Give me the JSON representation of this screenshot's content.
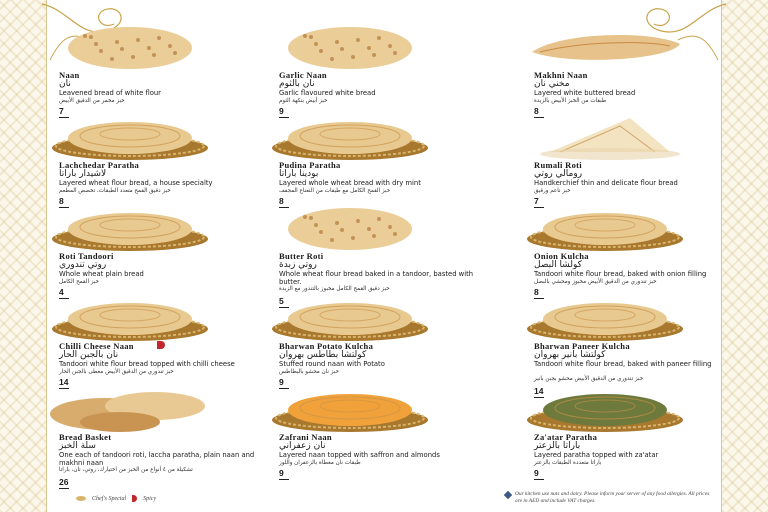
{
  "menu": {
    "items": [
      {
        "name": "Naan",
        "ar": "نان",
        "desc": "Leavened bread of white flour",
        "ardesc": "خبز مخمر من الدقيق الأبيض",
        "price": "7",
        "bread": "round",
        "spicy": false
      },
      {
        "name": "Garlic Naan",
        "ar": "نان بالثوم",
        "desc": "Garlic flavoured white bread",
        "ardesc": "خبز أبيض بنكهة الثوم",
        "price": "9",
        "bread": "round",
        "spicy": false
      },
      {
        "name": "Makhni Naan",
        "ar": "مخني نان",
        "desc": "Layered white buttered bread",
        "ardesc": "طبقات من الخبز الأبيض بالزبدة",
        "price": "8",
        "bread": "long",
        "spicy": false
      },
      {
        "name": "Lachchedar Paratha",
        "ar": "لاشيدار باراتا",
        "desc": "Layered wheat flour bread, a house specialty",
        "ardesc": "خبز دقيق القمح متعدد الطبقات، تخصص المطعم",
        "price": "8",
        "bread": "basket",
        "spicy": false
      },
      {
        "name": "Pudina Paratha",
        "ar": "بودينا باراتا",
        "desc": "Layered whole wheat bread with dry mint",
        "ardesc": "خبز القمح الكامل مع طبقات من النعناع المجفف",
        "price": "8",
        "bread": "basket",
        "spicy": false
      },
      {
        "name": "Rumali Roti",
        "ar": "رومالي روتي",
        "desc": "Handkerchief thin and delicate flour bread",
        "ardesc": "خبز ناعم ورقيق",
        "price": "7",
        "bread": "folded",
        "spicy": false
      },
      {
        "name": "Roti Tandoori",
        "ar": "روتي تندوري",
        "desc": "Whole wheat plain bread",
        "ardesc": "خبز القمح الكامل",
        "price": "4",
        "bread": "basket",
        "spicy": false
      },
      {
        "name": "Butter Roti",
        "ar": "روتي زبدة",
        "desc": "Whole wheat flour bread baked in a tandoor, basted with butter.",
        "ardesc": "خبز دقيق القمح الكامل مخبوز بالتندور مع الزبدة",
        "price": "5",
        "bread": "round",
        "spicy": false
      },
      {
        "name": "Onion Kulcha",
        "ar": "كولشا البصل",
        "desc": "Tandoori white flour bread, baked with onion filling",
        "ardesc": "خبز تندوري من الدقيق الأبيض مخبوز ومحشي بالبصل",
        "price": "8",
        "bread": "basket",
        "spicy": false
      },
      {
        "name": "Chilli Cheese Naan",
        "ar": "نان بالجبن الحار",
        "desc": "Tandoori white flour bread topped with chilli cheese",
        "ardesc": "خبز تندوري من الدقيق الأبيض مغطى بالجبن الحار",
        "price": "14",
        "bread": "basket",
        "spicy": true
      },
      {
        "name": "Bharwan Potato Kulcha",
        "ar": "كولتشا بطاطس بهروان",
        "desc": "Stuffed round naan with Potato",
        "ardesc": "خبز نان محشو بالبطاطس",
        "price": "9",
        "bread": "basket",
        "spicy": false
      },
      {
        "name": "Bharwan Paneer Kulcha",
        "ar": "كولتشا بانير بهروان",
        "desc": "Tandoori white flour bread, baked with paneer filling",
        "ardesc": "خبز تندوري من الدقيق الأبيض محشو بجبن بانير",
        "price": "14",
        "bread": "basket",
        "spicy": false
      },
      {
        "name": "Bread Basket",
        "ar": "سلة الخبز",
        "desc": "One each of tandoori roti, laccha paratha, plain naan and makhni naan",
        "ardesc": "تشكيلة من ٤ أنواع من الخبز من اختيارك، روتي، نان، باراتا",
        "price": "26",
        "bread": "pile",
        "spicy": false
      },
      {
        "name": "Zafrani Naan",
        "ar": "نان زعفراني",
        "desc": "Layered naan topped with saffron and almonds",
        "ardesc": "طبقات نان مغطاة بالزعفران واللوز",
        "price": "9",
        "bread": "saffron",
        "spicy": false
      },
      {
        "name": "Za'atar Paratha",
        "ar": "باراتا بالزعتر",
        "desc": "Layered paratha topped with za'atar",
        "ardesc": "باراتا متعددة الطبقات بالزعتر",
        "price": "9",
        "bread": "zaatar",
        "spicy": false
      }
    ]
  },
  "legend": {
    "chef_special": "Chef's Special",
    "spicy": "Spicy"
  },
  "footnote": "Our kitchen use nuts and dairy. Please inform your server of any food allergies. All prices are in AED and include VAT charges.",
  "colors": {
    "accent": "#c9a34a",
    "bread": "#e6c48a",
    "basket": "#b98a3e",
    "spicy": "#c0282d"
  }
}
